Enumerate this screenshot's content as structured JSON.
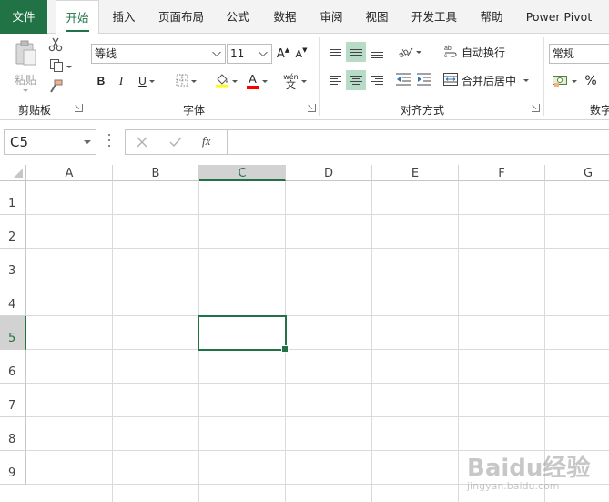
{
  "tabs": [
    {
      "label": "文件",
      "state": "file"
    },
    {
      "label": "开始",
      "state": "active"
    },
    {
      "label": "插入"
    },
    {
      "label": "页面布局"
    },
    {
      "label": "公式"
    },
    {
      "label": "数据"
    },
    {
      "label": "审阅"
    },
    {
      "label": "视图"
    },
    {
      "label": "开发工具"
    },
    {
      "label": "帮助"
    },
    {
      "label": "Power Pivot"
    }
  ],
  "ribbon": {
    "clipboard": {
      "label": "剪贴板",
      "paste": "粘贴",
      "icons": [
        "paste-icon",
        "cut-icon",
        "copy-icon",
        "format-painter-icon"
      ]
    },
    "font": {
      "label": "字体",
      "font_name": "等线",
      "font_size": "11",
      "bold": "B",
      "italic": "I",
      "underline": "U",
      "grow": "A",
      "shrink": "A",
      "font_color_letter": "A",
      "phonetic": "wén"
    },
    "alignment": {
      "label": "对齐方式",
      "wrap_text": "自动换行",
      "merge_center": "合并后居中",
      "pressed": [
        "align-middle",
        "align-center"
      ]
    },
    "number": {
      "label": "数字",
      "format": "常规",
      "percent": "%"
    }
  },
  "formula_bar": {
    "name_box": "C5",
    "fx": "fx",
    "value": ""
  },
  "grid": {
    "columns": [
      "A",
      "B",
      "C",
      "D",
      "E",
      "F",
      "G"
    ],
    "rows": [
      "1",
      "2",
      "3",
      "4",
      "5",
      "6",
      "7",
      "8",
      "9"
    ],
    "selected_column": "C",
    "selected_row": "5",
    "active_cell": "C5"
  },
  "colors": {
    "accent": "#217346",
    "pressed": "#b7dbc7",
    "header_selected": "#d2d2d2"
  },
  "watermark": {
    "text": "Baidu经验",
    "sub": "jingyan.baidu.com"
  }
}
